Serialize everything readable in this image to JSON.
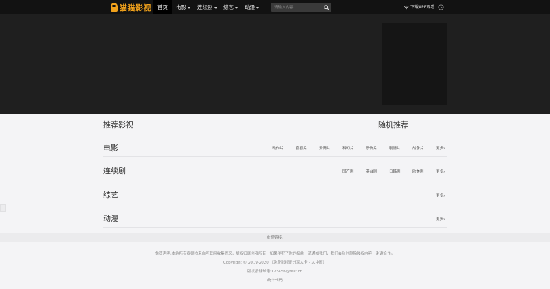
{
  "navbar": {
    "logo_text": "猫猫影视",
    "items": [
      {
        "label": "首页",
        "active": true,
        "dropdown": false
      },
      {
        "label": "电影",
        "dropdown": true
      },
      {
        "label": "连续剧",
        "dropdown": true
      },
      {
        "label": "综艺",
        "dropdown": true
      },
      {
        "label": "动漫",
        "dropdown": true
      }
    ],
    "search_placeholder": "请输入内容",
    "download_app_label": "下载APP观看",
    "icons": {
      "search": "search-icon",
      "wifi": "wifi-icon",
      "history": "clock-icon"
    }
  },
  "sections": {
    "recommend": {
      "title": "推荐影视"
    },
    "random": {
      "title": "随机推荐"
    },
    "movie": {
      "title": "电影",
      "categories": [
        "动作片",
        "喜剧片",
        "爱情片",
        "科幻片",
        "恐怖片",
        "剧情片",
        "战争片"
      ],
      "more": "更多»"
    },
    "series": {
      "title": "连续剧",
      "categories": [
        "国产剧",
        "港台剧",
        "日韩剧",
        "欧美剧"
      ],
      "more": "更多»"
    },
    "variety": {
      "title": "综艺",
      "more": "更多»"
    },
    "anime": {
      "title": "动漫",
      "more": "更多»"
    }
  },
  "footer": {
    "friend_links": "友情链接:",
    "disclaimer": "免责声明:本站所有视频均来自互联网收集而来，版权归原创者所有，如果侵犯了你的权益，请通知我们，我们会及时删除侵权内容，谢谢合作。",
    "copyright": "Copyright © 2019-2020 《免费影视爱分享大全 - 大中国》",
    "contact": "版权投诉邮箱:123456@test.cn",
    "stats": "统计代码"
  },
  "colors": {
    "navbar_bg": "#121212",
    "banner_bg": "#1f1f1f",
    "accent": "#f0a11c",
    "page_bg": "#f4f4f6"
  }
}
